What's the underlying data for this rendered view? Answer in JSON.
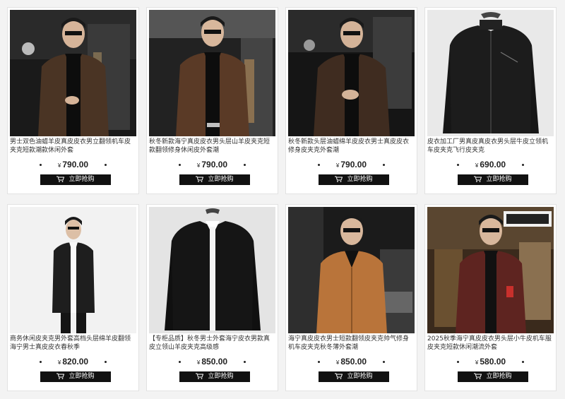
{
  "products": [
    {
      "title": "男士双色油蜡羊皮真皮皮衣男立翻领机车皮夹克短款潮款休闲外套",
      "currency": "¥",
      "price": "790.00",
      "buy_label": "立即抢购",
      "image_icon": "leather-jacket-photo"
    },
    {
      "title": "秋冬新款海宁真皮皮衣男头层山羊皮夹克短款翻领修身休闲皮外套潮",
      "currency": "¥",
      "price": "790.00",
      "buy_label": "立即抢购",
      "image_icon": "leather-jacket-photo"
    },
    {
      "title": "秋冬新款头层油蜡绵羊皮皮衣男士真皮皮衣修身皮夹克外套潮",
      "currency": "¥",
      "price": "790.00",
      "buy_label": "立即抢购",
      "image_icon": "leather-jacket-photo"
    },
    {
      "title": "皮衣加工厂男真皮真皮衣男头层牛皮立领机车皮夹克飞行皮夹克",
      "currency": "¥",
      "price": "690.00",
      "buy_label": "立即抢购",
      "image_icon": "leather-jacket-photo"
    },
    {
      "title": "商务休闲皮夹克男外套高档头层绵羊皮翻领海宁男士真皮皮衣春秋季",
      "currency": "¥",
      "price": "820.00",
      "buy_label": "立即抢购",
      "image_icon": "leather-jacket-photo"
    },
    {
      "title": "【专柜品质】秋冬男士外套海宁皮衣男款真皮立领山羊皮夹克高级感",
      "currency": "¥",
      "price": "850.00",
      "buy_label": "立即抢购",
      "image_icon": "leather-jacket-photo"
    },
    {
      "title": "海宁真皮皮衣男士短款翻领皮夹克帅气修身机车皮夹克秋冬薄外套潮",
      "currency": "¥",
      "price": "850.00",
      "buy_label": "立即抢购",
      "image_icon": "leather-jacket-photo"
    },
    {
      "title": "2025秋季海宁真皮皮衣男头层小牛皮机车服皮夹克短款休闲潮流外套",
      "currency": "¥",
      "price": "580.00",
      "buy_label": "立即抢购",
      "image_icon": "leather-jacket-photo"
    }
  ],
  "colors": {
    "button_bg": "#111111",
    "button_text": "#ffffff",
    "page_bg": "#f3f3f3",
    "card_bg": "#ffffff"
  }
}
